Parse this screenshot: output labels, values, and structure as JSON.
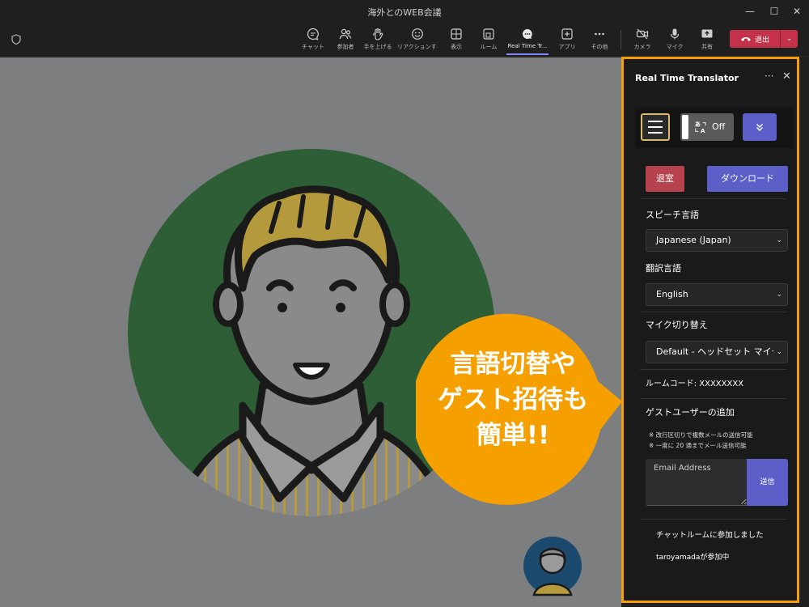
{
  "window": {
    "title": "海外とのWEB会議",
    "minimize": "—",
    "maximize": "☐",
    "close": "✕"
  },
  "toolbar": {
    "items": [
      {
        "label": "チャット",
        "icon": "chat-icon"
      },
      {
        "label": "参加者",
        "icon": "people-icon"
      },
      {
        "label": "手を上げる",
        "icon": "raise-hand-icon"
      },
      {
        "label": "リアクションする",
        "icon": "reaction-icon"
      },
      {
        "label": "表示",
        "icon": "view-icon"
      },
      {
        "label": "ルーム",
        "icon": "room-icon"
      },
      {
        "label": "Real Time Tr...",
        "icon": "app-icon",
        "active": true
      },
      {
        "label": "アプリ",
        "icon": "apps-add-icon"
      },
      {
        "label": "その他",
        "icon": "more-icon"
      },
      {
        "label": "カメラ",
        "icon": "camera-off-icon"
      },
      {
        "label": "マイク",
        "icon": "mic-icon"
      },
      {
        "label": "共有",
        "icon": "share-icon"
      }
    ],
    "leave_label": "退出",
    "leave_color": "#c4314b"
  },
  "panel": {
    "title": "Real Time Translator",
    "more": "···",
    "close": "✕",
    "accent_border": "#f5a000",
    "toggle_state": "Off",
    "exit_label": "退室",
    "download_label": "ダウンロード",
    "speech_label": "スピーチ言語",
    "speech_value": "Japanese (Japan)",
    "translate_label": "翻訳言語",
    "translate_value": "English",
    "mic_label": "マイク切り替え",
    "mic_value": "Default - ヘッドセット マイク",
    "room_code": "ルームコード: XXXXXXXX",
    "guest_title": "ゲストユーザーの追加",
    "note1": "※ 改行区切りで複数メールの送信可能",
    "note2": "※ 一度に 20 通までメール送信可能",
    "email_placeholder": "Email Address",
    "send_label": "送信",
    "messages": [
      "チャットルームに参加しました",
      "taroyamadaが参加中"
    ]
  },
  "callout": {
    "lines": [
      "言語切替や",
      "ゲスト招待も",
      "簡単!!"
    ],
    "color": "#f5a000"
  }
}
